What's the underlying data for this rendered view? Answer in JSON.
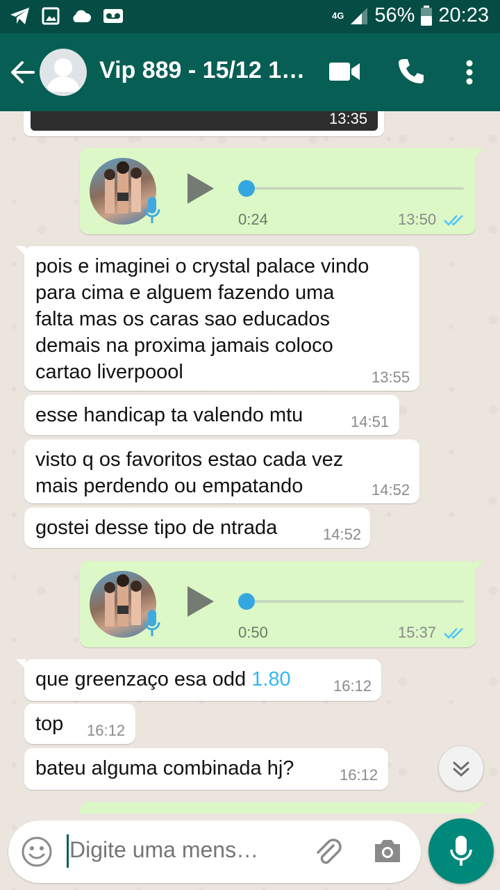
{
  "status_bar": {
    "network": "4G",
    "battery_percent": "56%",
    "clock": "20:23",
    "icons": [
      "telegram-icon",
      "image-icon",
      "cloud-icon",
      "voicemail-icon",
      "signal-icon",
      "battery-icon"
    ]
  },
  "header": {
    "title": "Vip 889 - 15/12 1…",
    "icons": [
      "back-arrow-icon",
      "group-avatar-icon",
      "video-call-icon",
      "phone-call-icon",
      "more-vert-icon"
    ]
  },
  "messages": [
    {
      "type": "image",
      "direction": "in",
      "time": "13:35"
    },
    {
      "type": "voice",
      "direction": "out",
      "duration": "0:24",
      "time": "13:50",
      "status": "read"
    },
    {
      "type": "text",
      "direction": "in",
      "lines": [
        "pois e imaginei o crystal palace vindo",
        "para cima e alguem fazendo uma",
        "falta mas os caras sao educados",
        "demais na proxima jamais coloco",
        "cartao liverpoool"
      ],
      "time": "13:55"
    },
    {
      "type": "text",
      "direction": "in",
      "lines": [
        "esse handicap ta valendo mtu"
      ],
      "time": "14:51"
    },
    {
      "type": "text",
      "direction": "in",
      "lines": [
        "visto q os favoritos estao cada vez",
        "mais perdendo ou empatando"
      ],
      "time": "14:52"
    },
    {
      "type": "text",
      "direction": "in",
      "lines": [
        "gostei desse tipo de ntrada"
      ],
      "time": "14:52"
    },
    {
      "type": "voice",
      "direction": "out",
      "duration": "0:50",
      "time": "15:37",
      "status": "read"
    },
    {
      "type": "text",
      "direction": "in",
      "text_before": "que greenzaço esa odd ",
      "highlight": "1.80",
      "time": "16:12"
    },
    {
      "type": "text",
      "direction": "in",
      "lines": [
        "top"
      ],
      "time": "16:12"
    },
    {
      "type": "text",
      "direction": "in",
      "lines": [
        "bateu alguma combinada hj?"
      ],
      "time": "16:12"
    }
  ],
  "input": {
    "placeholder": "Digite uma mens…",
    "icons": [
      "emoji-icon",
      "attach-icon",
      "camera-icon",
      "mic-icon"
    ]
  },
  "colors": {
    "status_bar": "#054d44",
    "header": "#075e54",
    "outgoing_bubble": "#dcf8c6",
    "incoming_bubble": "#ffffff",
    "read_ticks": "#4fc3f7",
    "voice_progress": "#34a7e0",
    "mic_button": "#00897b"
  }
}
